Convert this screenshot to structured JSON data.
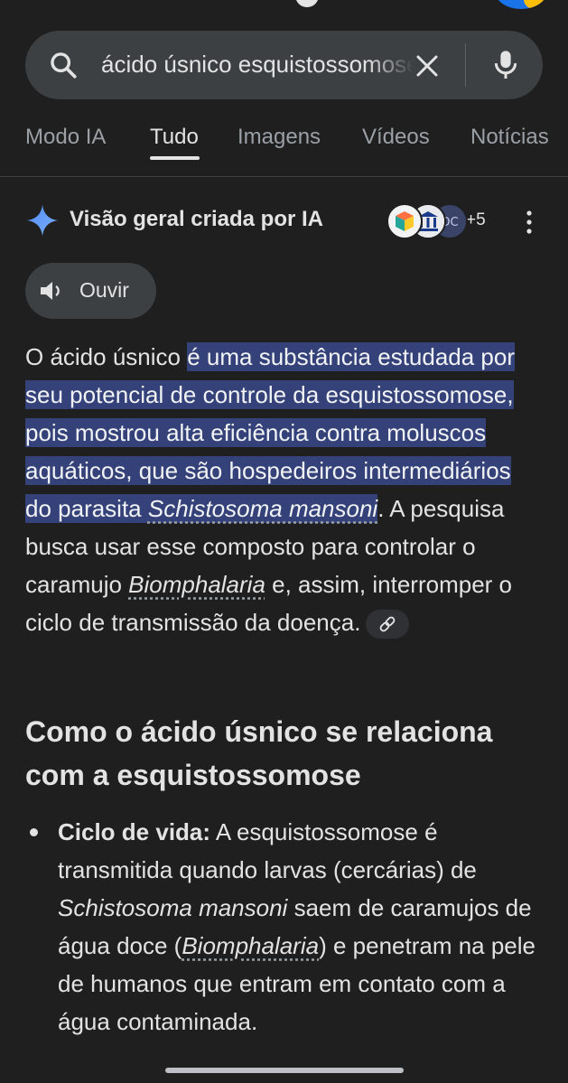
{
  "search": {
    "query": "ácido úsnico esquistossomose",
    "search_icon": "search-icon",
    "clear_icon": "close-icon",
    "mic_icon": "mic-icon"
  },
  "tabs": [
    {
      "label": "Modo IA",
      "active": false
    },
    {
      "label": "Tudo",
      "active": true
    },
    {
      "label": "Imagens",
      "active": false
    },
    {
      "label": "Vídeos",
      "active": false
    },
    {
      "label": "Notícias",
      "active": false
    }
  ],
  "ai_overview": {
    "title": "Visão geral criada por IA",
    "spark_icon": "gemini-spark-icon",
    "sources_more": "+5",
    "menu_icon": "more-vert-icon",
    "listen_label": "Ouvir",
    "listen_icon": "speaker-icon",
    "paragraph": {
      "lead": "O ácido úsnico ",
      "highlight_1": "é uma substância estudada por seu potencial de controle da esquistossomose, pois mostrou alta eficiência contra moluscos aquáticos, que são hospedeiros intermediários do parasita ",
      "highlight_term": "Schistosoma mansoni",
      "rest_1": ". A pesquisa busca usar esse composto para controlar o caramujo ",
      "term_2": "Biomphalaria",
      "rest_2": " e, assim, interromper o ciclo de transmissão da doença.",
      "link_icon": "link-icon"
    },
    "section_heading": "Como o ácido úsnico se relaciona com a esquistossomose",
    "bullets": [
      {
        "label": "Ciclo de vida:",
        "text_1": " A esquistossomose é transmitida quando larvas (cercárias) de ",
        "term_1": "Schistosoma mansoni",
        "text_2": " saem de caramujos de água doce (",
        "term_2": "Biomphalaria",
        "text_3": ") e penetram na pele de humanos que entram em contato com a água contaminada."
      }
    ]
  },
  "colors": {
    "background": "#1f1f1f",
    "search_bg": "#3c4043",
    "highlight": "#35427a",
    "text": "#e3e3e3"
  }
}
